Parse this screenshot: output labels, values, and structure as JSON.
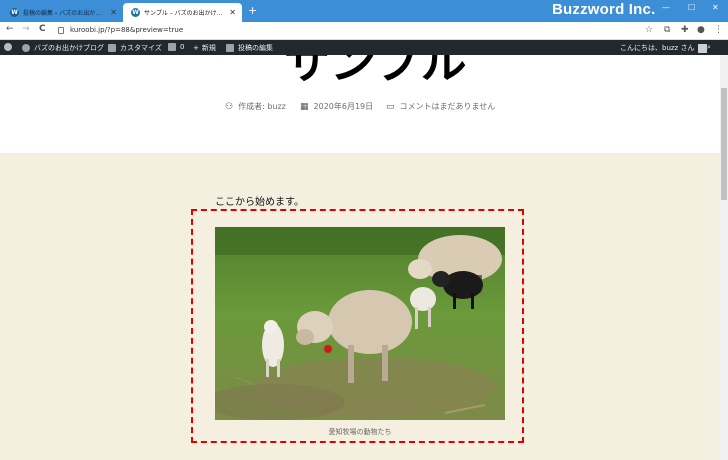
{
  "browser": {
    "tabs": [
      {
        "title": "投稿の編集 ‹ バズのお出かけブログ — WordPress",
        "close": "✕"
      },
      {
        "title": "サンプル – バズのお出かけブログ",
        "close": "✕"
      }
    ],
    "new_tab": "+",
    "brand": "Buzzword Inc.",
    "window_controls": {
      "minimize": "—",
      "maximize": "☐",
      "close": "✕"
    },
    "nav": {
      "back": "←",
      "forward": "→",
      "reload": "C"
    },
    "url": "kuroobi.jp/?p=88&preview=true",
    "right_icons": {
      "star": "☆",
      "extension": "⧉",
      "puzzle": "✚",
      "profile": "●",
      "menu": "⋮"
    }
  },
  "adminbar": {
    "site": "バズのお出かけブログ",
    "customize": "カスタマイズ",
    "comments_count": "0",
    "new": "新規",
    "edit_post": "投稿の編集",
    "greeting": "こんにちは、buzz さん"
  },
  "post": {
    "title": "サンプル",
    "author": "作成者: buzz",
    "date": "2020年6月19日",
    "comments": "コメントはまだありません",
    "intro": "ここから始めます。",
    "caption": "愛知牧場の動物たち"
  }
}
